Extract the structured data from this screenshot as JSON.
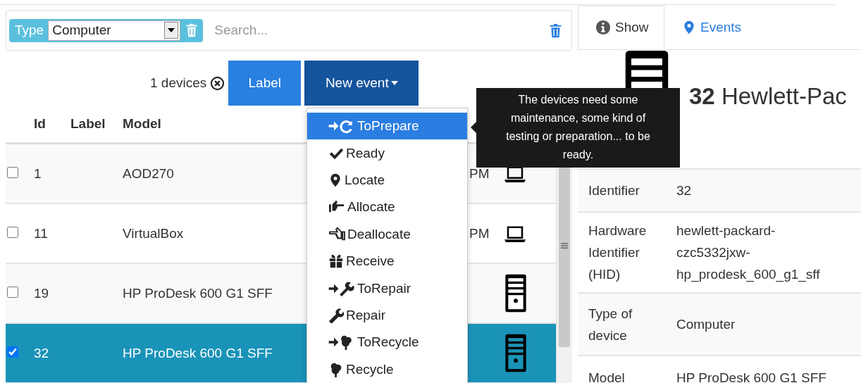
{
  "filter": {
    "type_label": "Type",
    "type_value": "Computer",
    "search": {
      "placeholder": "Search..."
    }
  },
  "toolbar": {
    "count": "1 devices",
    "buttons": [
      "Label",
      "New event"
    ]
  },
  "table": {
    "columns": [
      "Id",
      "Label",
      "Model"
    ],
    "rows": [
      {
        "id": "1",
        "model": "AOD270",
        "column_4": "PM",
        "kind": "laptop",
        "checked": false,
        "selected": false
      },
      {
        "id": "11",
        "model": "VirtualBox",
        "column_4": "PM",
        "kind": "laptop",
        "checked": false,
        "selected": false
      },
      {
        "id": "19",
        "model": "HP ProDesk 600 G1 SFF",
        "kind": "tower",
        "checked": false,
        "selected": false
      },
      {
        "id": "32",
        "model": "HP ProDesk 600 G1 SFF",
        "kind": "tower",
        "checked": true,
        "selected": true
      }
    ]
  },
  "event_menu": {
    "items": [
      {
        "label": "ToPrepare",
        "selected": true
      },
      {
        "label": "Ready",
        "selected": false
      },
      {
        "label": "Locate",
        "selected": false
      },
      {
        "label": "Allocate",
        "selected": false
      },
      {
        "label": "Deallocate",
        "selected": false
      },
      {
        "label": "Receive",
        "selected": false
      },
      {
        "label": "ToRepair",
        "selected": false
      },
      {
        "label": "Repair",
        "selected": false
      },
      {
        "label": "ToRecycle",
        "selected": false
      },
      {
        "label": "Recycle",
        "selected": false
      }
    ]
  },
  "tooltip": {
    "text": "The devices need some maintenance, some kind of testing or preparation... to be ready."
  },
  "detail": {
    "tabs": [
      {
        "label": "Show",
        "selected": true
      },
      {
        "label": "Events",
        "selected": false
      }
    ],
    "title": "**32** Hewlett-Pac",
    "fields": [
      {
        "label": "Identifier",
        "value": "32"
      },
      {
        "label": "Hardware Identifier (HID)",
        "value": "hewlett-packard-czc5332jxw-hp_prodesk_600_g1_sff"
      },
      {
        "label": "Type of device",
        "value": "Computer"
      },
      {
        "label": "Model",
        "value": "HP ProDesk 600 G1 SFF"
      }
    ]
  }
}
